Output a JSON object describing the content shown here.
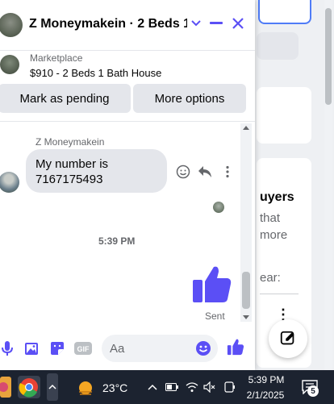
{
  "chat": {
    "title": "Z Moneymakein · 2 Beds 1 ...",
    "listing": {
      "source": "Marketplace",
      "title": "$910 - 2 Beds 1 Bath House"
    },
    "actions": {
      "mark_pending": "Mark as pending",
      "more_options": "More options"
    },
    "messages": [
      {
        "sender": "Z Moneymakein",
        "text_line1": "My number is",
        "text_line2": "7167175493"
      }
    ],
    "timestamp": "5:39 PM",
    "sent_status": "Sent",
    "composer": {
      "placeholder": "Aa"
    },
    "accent_color": "#5b4ff5"
  },
  "background": {
    "heading": "uyers",
    "line1": "that",
    "line2": "more",
    "line3": "ear:"
  },
  "taskbar": {
    "temperature": "23°C",
    "time": "5:39 PM",
    "date": "2/1/2025",
    "notification_count": "5"
  }
}
